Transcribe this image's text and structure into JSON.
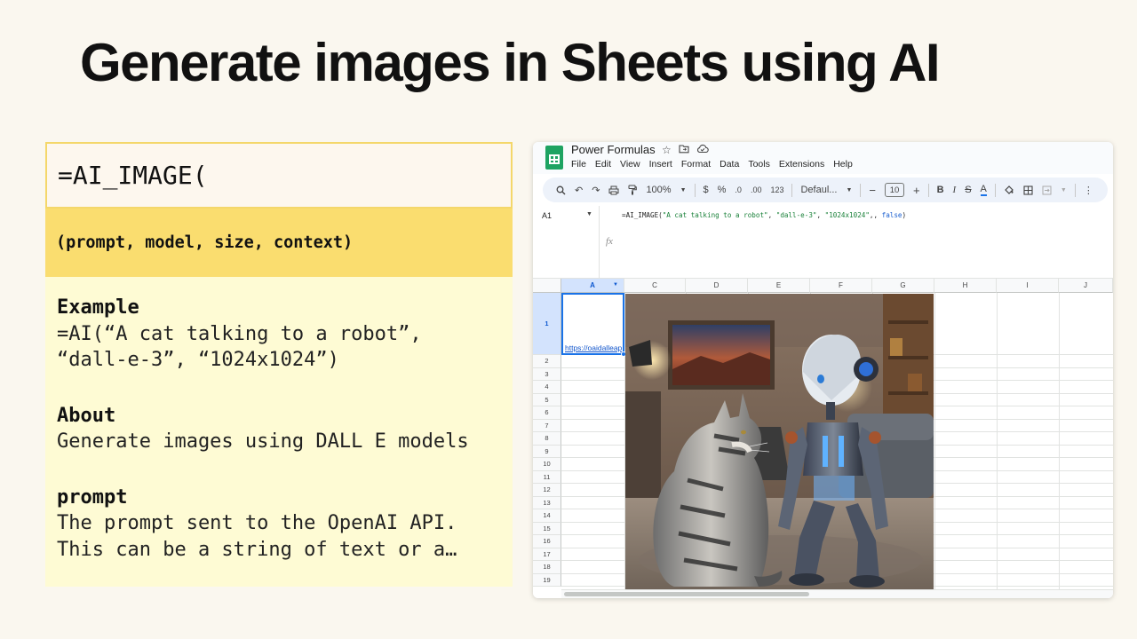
{
  "slide": {
    "title": "Generate images in Sheets using AI"
  },
  "card": {
    "header": "=AI_IMAGE(",
    "params": "(prompt, model, size, context)",
    "example_heading": "Example",
    "example_line1": "=AI(“A cat talking to a robot”,",
    "example_line2": "“dall-e-3”, “1024x1024”)",
    "about_heading": "About",
    "about_text": "Generate images using DALL E models",
    "prompt_heading": "prompt",
    "prompt_line1": "The prompt sent to the OpenAI API.",
    "prompt_line2": "This can be a string of text or a…"
  },
  "sheet": {
    "doc_title": "Power Formulas",
    "title_icons": [
      "star-icon",
      "move-to-folder-icon",
      "cloud-status-icon"
    ],
    "menu": [
      "File",
      "Edit",
      "View",
      "Insert",
      "Format",
      "Data",
      "Tools",
      "Extensions",
      "Help"
    ],
    "toolbar": {
      "zoom": "100%",
      "currency": "$",
      "percent": "%",
      "decrease_decimal": ".0",
      "increase_decimal": ".00",
      "number_format": "123",
      "font": "Defaul...",
      "font_size": "10",
      "bold": "B",
      "italic": "I",
      "strike": "S",
      "text_color": "A"
    },
    "name_box": "A1",
    "formula": {
      "prefix": "=AI_IMAGE(",
      "arg1": "\"A cat talking to a robot\"",
      "sep1": ", ",
      "arg2": "\"dall-e-3\"",
      "sep2": ", ",
      "arg3": "\"1024x1024\"",
      "sep3": ",, ",
      "arg4": "false",
      "suffix": ")"
    },
    "columns": [
      "A",
      "C",
      "D",
      "E",
      "F",
      "G",
      "H",
      "I",
      "J"
    ],
    "rows": [
      "1",
      "2",
      "3",
      "4",
      "5",
      "6",
      "7",
      "8",
      "9",
      "10",
      "11",
      "12",
      "13",
      "14",
      "15",
      "16",
      "17",
      "18",
      "19"
    ],
    "a1_value": "https://oaidalleap",
    "image_description_icon": "ai-generated-image-cat-and-robot"
  },
  "colors": {
    "background": "#faf7ef",
    "card_header_border": "#f4d76a",
    "card_params": "#fadd6f",
    "card_body": "#fefbd4",
    "sheets_green": "#1ea362",
    "selection_blue": "#1a73e8"
  }
}
